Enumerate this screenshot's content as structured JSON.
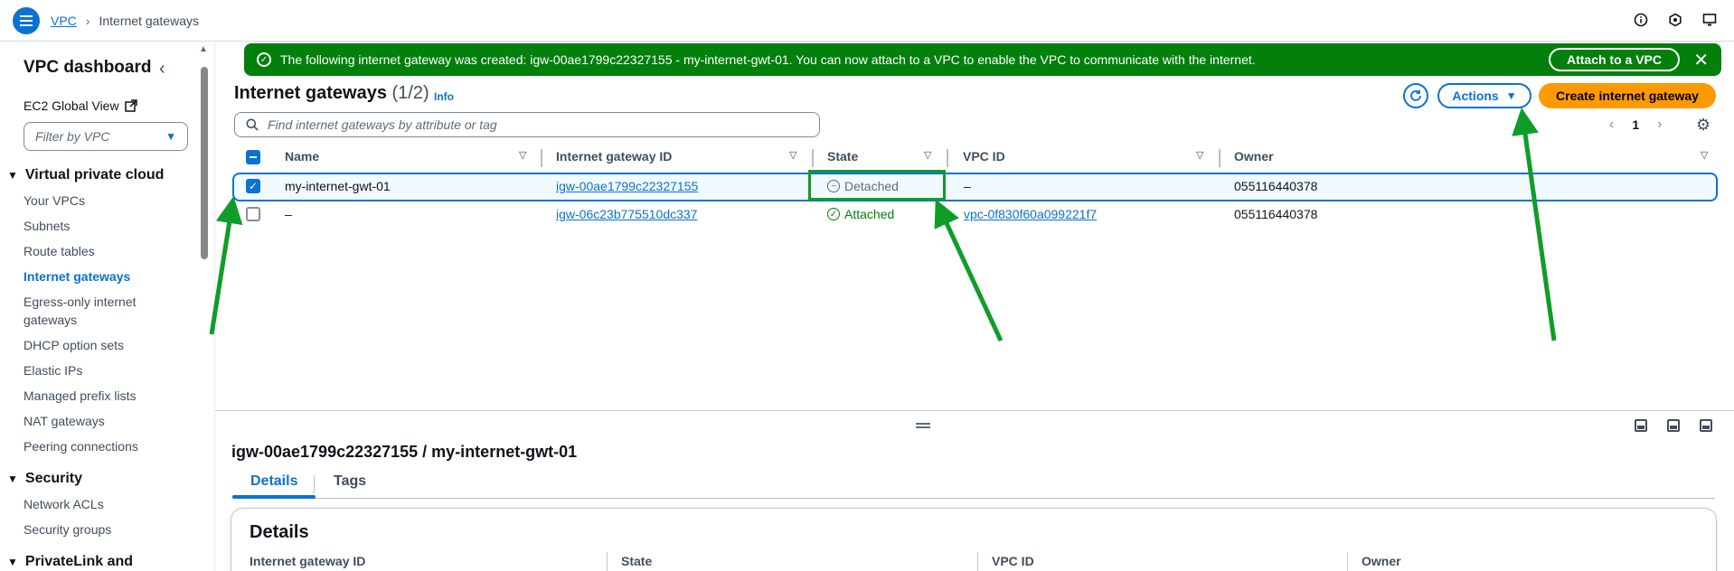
{
  "topbar": {
    "breadcrumb_root": "VPC",
    "breadcrumb_current": "Internet gateways"
  },
  "sidebar": {
    "title": "VPC dashboard",
    "ec2_global_view": "EC2 Global View",
    "filter_placeholder": "Filter by VPC",
    "section_vpc": "Virtual private cloud",
    "items": [
      {
        "label": "Your VPCs"
      },
      {
        "label": "Subnets"
      },
      {
        "label": "Route tables"
      },
      {
        "label": "Internet gateways"
      },
      {
        "label": "Egress-only internet"
      },
      {
        "label": "gateways"
      },
      {
        "label": "DHCP option sets"
      },
      {
        "label": "Elastic IPs"
      },
      {
        "label": "Managed prefix lists"
      },
      {
        "label": "NAT gateways"
      },
      {
        "label": "Peering connections"
      }
    ],
    "section_security": "Security",
    "security_items": [
      {
        "label": "Network ACLs"
      },
      {
        "label": "Security groups"
      }
    ],
    "section_privatelink": "PrivateLink and"
  },
  "banner": {
    "message": "The following internet gateway was created: igw-00ae1799c22327155 - my-internet-gwt-01. You can now attach to a VPC to enable the VPC to communicate with the internet.",
    "action_label": "Attach to a VPC",
    "close": "✕"
  },
  "main": {
    "title": "Internet gateways",
    "count": "(1/2)",
    "info": "Info",
    "actions_label": "Actions",
    "create_label": "Create internet gateway",
    "search_placeholder": "Find internet gateways by attribute or tag",
    "page": "1"
  },
  "table": {
    "columns": [
      "Name",
      "Internet gateway ID",
      "State",
      "VPC ID",
      "Owner"
    ],
    "rows": [
      {
        "name": "my-internet-gwt-01",
        "id": "igw-00ae1799c22327155",
        "state": "Detached",
        "vpc": "–",
        "owner": "055116440378"
      },
      {
        "name": "–",
        "id": "igw-06c23b775510dc337",
        "state": "Attached",
        "vpc": "vpc-0f830f60a099221f7",
        "owner": "055116440378"
      }
    ]
  },
  "details": {
    "title": "igw-00ae1799c22327155 / my-internet-gwt-01",
    "tabs": [
      "Details",
      "Tags"
    ],
    "card_title": "Details",
    "fields": [
      "Internet gateway ID",
      "State",
      "VPC ID",
      "Owner"
    ]
  },
  "colors": {
    "accent": "#0972d3",
    "success": "#037f0c",
    "primary_button": "#ff9900",
    "annotation": "#0f9d27"
  }
}
